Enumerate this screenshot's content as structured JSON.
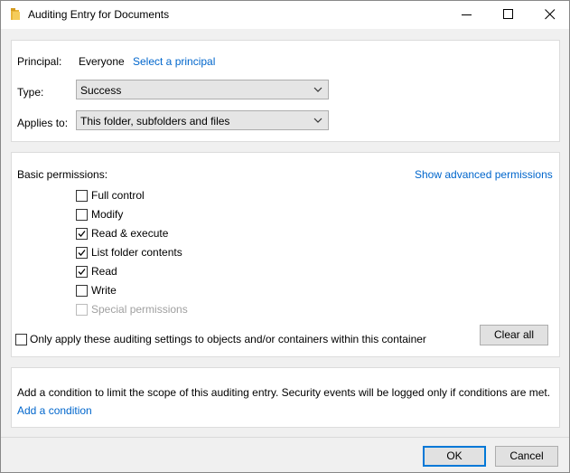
{
  "window": {
    "title": "Auditing Entry for Documents",
    "icon": "folder-icon",
    "controls": [
      "minimize-icon",
      "maximize-icon",
      "close-icon"
    ]
  },
  "principal": {
    "label": "Principal:",
    "value": "Everyone",
    "select_link": "Select a principal"
  },
  "type": {
    "label": "Type:",
    "selected": "Success"
  },
  "applies_to": {
    "label": "Applies to:",
    "selected": "This folder, subfolders and files"
  },
  "permissions": {
    "heading": "Basic permissions:",
    "advanced_link": "Show advanced permissions",
    "items": [
      {
        "label": "Full control",
        "checked": false,
        "disabled": false
      },
      {
        "label": "Modify",
        "checked": false,
        "disabled": false
      },
      {
        "label": "Read & execute",
        "checked": true,
        "disabled": false
      },
      {
        "label": "List folder contents",
        "checked": true,
        "disabled": false
      },
      {
        "label": "Read",
        "checked": true,
        "disabled": false
      },
      {
        "label": "Write",
        "checked": false,
        "disabled": false
      },
      {
        "label": "Special permissions",
        "checked": false,
        "disabled": true
      }
    ],
    "only_apply_label": "Only apply these auditing settings to objects and/or containers within this container",
    "only_apply_checked": false,
    "clear_all_label": "Clear all"
  },
  "condition": {
    "text": "Add a condition to limit the scope of this auditing entry. Security events will be logged only if conditions are met.",
    "add_link": "Add a condition"
  },
  "footer": {
    "ok_label": "OK",
    "cancel_label": "Cancel"
  }
}
